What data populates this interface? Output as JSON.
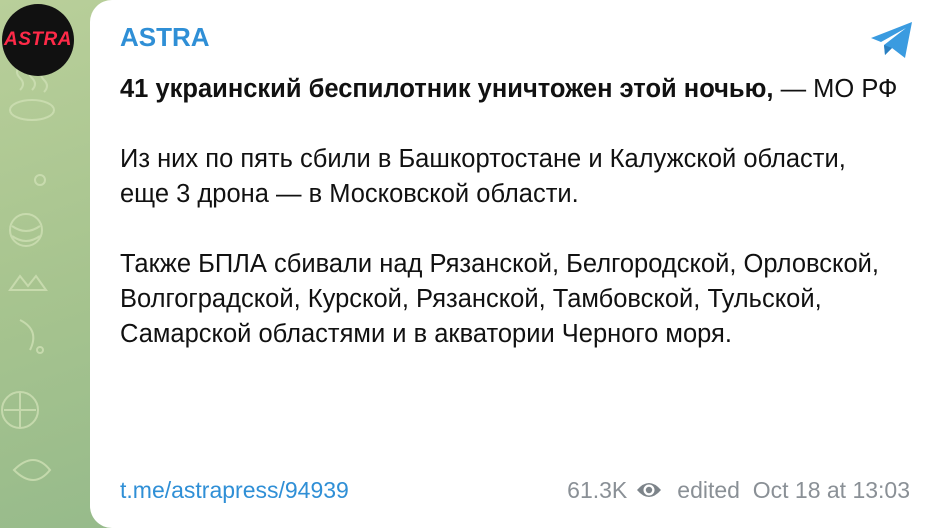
{
  "avatar": {
    "text": "ASTRA"
  },
  "post": {
    "channel_name": "ASTRA",
    "headline_bold": "41 украинский беспилотник уничтожен этой ночью,",
    "headline_suffix": " — МО РФ",
    "paragraph_2": "Из них по пять сбили в Башкортостане и Калужской области, еще 3 дрона — в Московской области.",
    "paragraph_3": "Также БПЛА сбивали над Рязанской, Белгородской, Орловской, Волгоградской, Курской, Рязанской, Тамбовской, Тульской, Самарской областями и в акватории Черного моря.",
    "link": "t.me/astrapress/94939",
    "views": "61.3K",
    "edited_time": "edited  Oct 18 at 13:03"
  },
  "colors": {
    "accent": "#2f8fd6",
    "muted": "#8a9096",
    "avatar_red": "#ff2a48"
  },
  "icons": {
    "share": "telegram-share-icon",
    "views": "eye-icon"
  }
}
